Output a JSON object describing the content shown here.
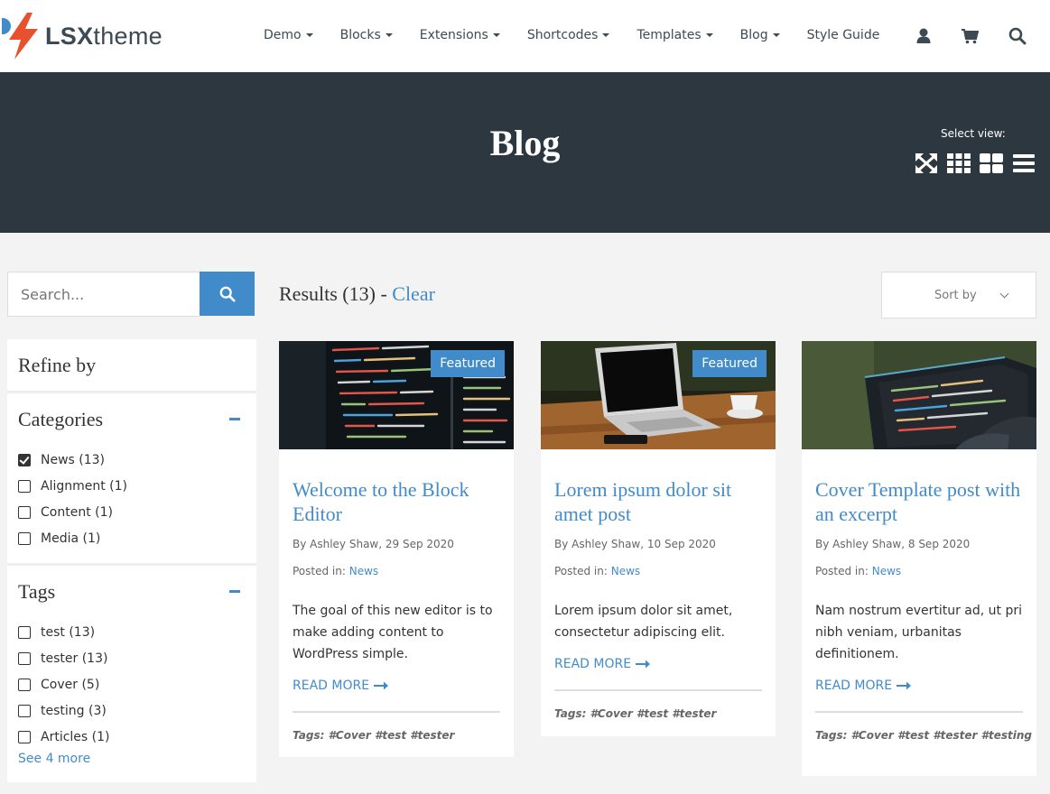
{
  "header": {
    "logo": {
      "bold": "LSX",
      "light": "theme"
    },
    "nav": [
      {
        "label": "Demo",
        "dropdown": true
      },
      {
        "label": "Blocks",
        "dropdown": true
      },
      {
        "label": "Extensions",
        "dropdown": true
      },
      {
        "label": "Shortcodes",
        "dropdown": true
      },
      {
        "label": "Templates",
        "dropdown": true
      },
      {
        "label": "Blog",
        "dropdown": true
      },
      {
        "label": "Style Guide",
        "dropdown": false
      }
    ],
    "icons": [
      "user-icon",
      "cart-icon",
      "search-icon"
    ]
  },
  "banner": {
    "title": "Blog",
    "view_label": "Select view:",
    "view_icons": [
      "expand-icon",
      "grid-small-icon",
      "grid-large-icon",
      "list-icon"
    ]
  },
  "sidebar": {
    "search_placeholder": "Search...",
    "refine_title": "Refine by",
    "categories": {
      "title": "Categories",
      "items": [
        {
          "label": "News (13)",
          "checked": true
        },
        {
          "label": "Alignment (1)",
          "checked": false
        },
        {
          "label": "Content (1)",
          "checked": false
        },
        {
          "label": "Media (1)",
          "checked": false
        }
      ]
    },
    "tags": {
      "title": "Tags",
      "items": [
        {
          "label": "test (13)",
          "checked": false
        },
        {
          "label": "tester (13)",
          "checked": false
        },
        {
          "label": "Cover (5)",
          "checked": false
        },
        {
          "label": "testing (3)",
          "checked": false
        },
        {
          "label": "Articles (1)",
          "checked": false
        }
      ],
      "see_more": "See 4 more"
    }
  },
  "results": {
    "label": "Results (13) - ",
    "clear": "Clear",
    "sort_label": "Sort by"
  },
  "posts": [
    {
      "badge": "Featured",
      "title": "Welcome to the Block Editor",
      "meta": "By Ashley Shaw, 29 Sep 2020",
      "posted_label": "Posted in: ",
      "category": "News",
      "excerpt": "The goal of this new editor is to make adding content to WordPress simple.",
      "read_more": "READ MORE",
      "tags": "Tags: #Cover  #test  #tester"
    },
    {
      "badge": "Featured",
      "title": "Lorem ipsum dolor sit amet post",
      "meta": "By Ashley Shaw, 10 Sep 2020",
      "posted_label": "Posted in: ",
      "category": "News",
      "excerpt": "Lorem ipsum dolor sit amet, consectetur adipiscing elit.",
      "read_more": "READ MORE",
      "tags": "Tags: #Cover  #test  #tester"
    },
    {
      "badge": "",
      "title": "Cover Template post with an excerpt",
      "meta": "By Ashley Shaw, 8 Sep 2020",
      "posted_label": "Posted in: ",
      "category": "News",
      "excerpt": "Nam nostrum evertitur ad, ut pri nibh veniam, urbanitas definitionem.",
      "read_more": "READ MORE",
      "tags": "Tags: #Cover  #test  #tester  #testing"
    }
  ],
  "colors": {
    "accent": "#428bca",
    "banner": "#2d3740",
    "logo_bolt": "#e8512e"
  }
}
